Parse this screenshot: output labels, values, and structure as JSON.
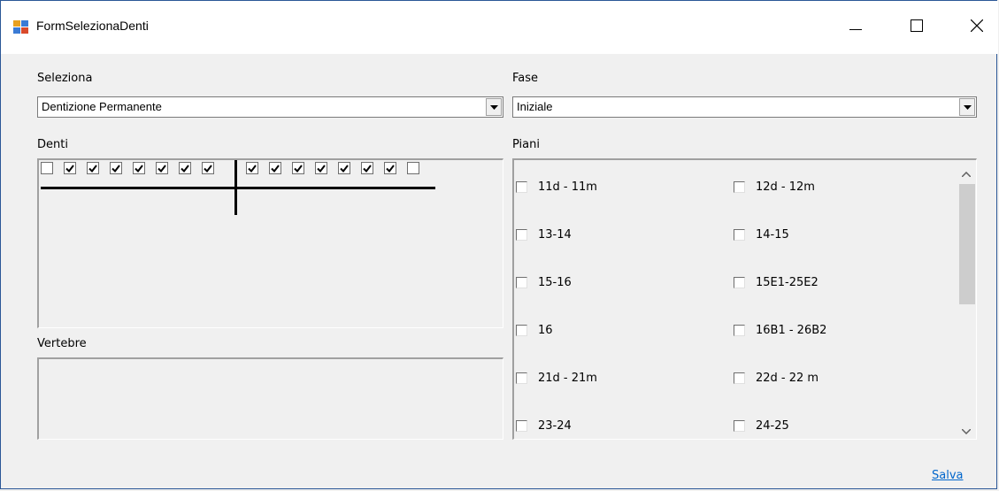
{
  "window": {
    "title": "FormSelezionaDenti",
    "minimize_glyph": "—",
    "close_glyph": "✕"
  },
  "seleziona": {
    "label": "Seleziona",
    "value": "Dentizione Permanente"
  },
  "fase": {
    "label": "Fase",
    "value": "Iniziale"
  },
  "denti": {
    "label": "Denti",
    "upper_left": [
      false,
      true,
      true,
      true,
      true,
      true,
      true,
      true
    ],
    "upper_right": [
      true,
      true,
      true,
      true,
      true,
      true,
      true,
      false
    ]
  },
  "vertebre": {
    "label": "Vertebre"
  },
  "piani": {
    "label": "Piani",
    "items": [
      {
        "label": "11d - 11m",
        "checked": false
      },
      {
        "label": "12d - 12m",
        "checked": false
      },
      {
        "label": "13-14",
        "checked": false
      },
      {
        "label": "14-15",
        "checked": false
      },
      {
        "label": "15-16",
        "checked": false
      },
      {
        "label": "15E1-25E2",
        "checked": false
      },
      {
        "label": "16",
        "checked": false
      },
      {
        "label": "16B1 - 26B2",
        "checked": false
      },
      {
        "label": "21d - 21m",
        "checked": false
      },
      {
        "label": "22d - 22 m",
        "checked": false
      },
      {
        "label": "23-24",
        "checked": false
      },
      {
        "label": "24-25",
        "checked": false
      }
    ]
  },
  "footer": {
    "save_label": "Salva"
  },
  "icons": {
    "app": "app-icon",
    "minimize": "minimize-icon",
    "maximize": "maximize-icon",
    "close": "close-icon",
    "dropdown": "chevron-down-icon",
    "scroll_up": "scroll-up-icon",
    "scroll_down": "scroll-down-icon"
  }
}
